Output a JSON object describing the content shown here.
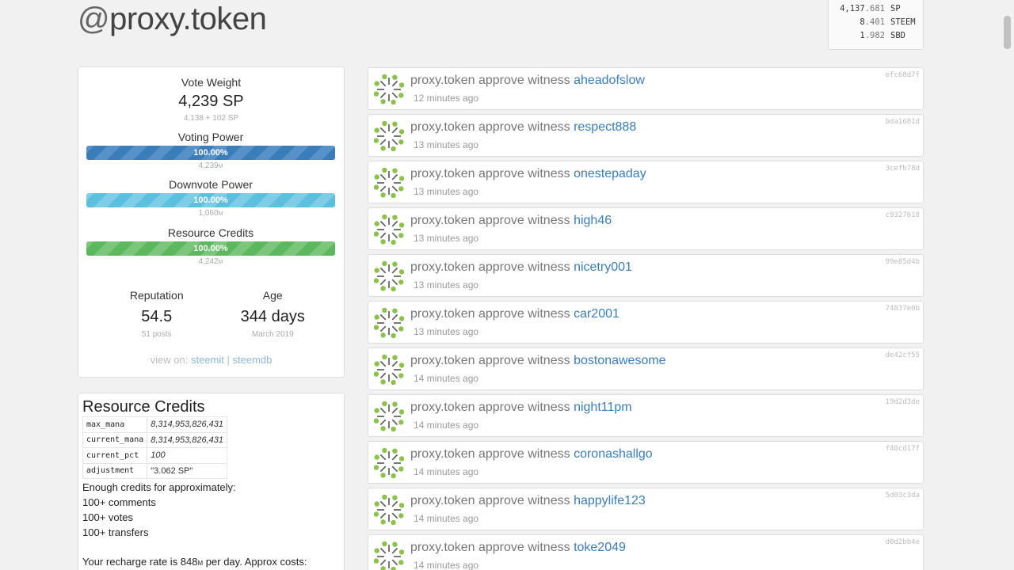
{
  "account": {
    "at": "@",
    "name": "proxy.token"
  },
  "balances": [
    {
      "int": "4,137",
      "dec": ".681",
      "symbol": "SP"
    },
    {
      "int": "8",
      "dec": ".401",
      "symbol": "STEEM"
    },
    {
      "int": "1",
      "dec": ".982",
      "symbol": "SBD"
    }
  ],
  "stats": {
    "vote_weight": {
      "label": "Vote Weight",
      "value": "4,239 SP",
      "sub": "4,138 + 102 SP"
    },
    "voting_power": {
      "label": "Voting Power",
      "percent": "100.00%",
      "fill": 1.0,
      "sub": "4,239",
      "unit": "M"
    },
    "downvote_power": {
      "label": "Downvote Power",
      "percent": "100.00%",
      "fill": 1.0,
      "sub": "1,060",
      "unit": "M"
    },
    "resource_credits": {
      "label": "Resource Credits",
      "percent": "100.00%",
      "fill": 1.0,
      "sub": "4,242",
      "unit": "M"
    },
    "reputation": {
      "label": "Reputation",
      "value": "54.5",
      "sub": "51 posts"
    },
    "age": {
      "label": "Age",
      "value": "344 days",
      "sub": "March 2019"
    },
    "view_on": {
      "prefix": "view on:",
      "steemit": "steemit",
      "sep": "|",
      "steemdb": "steemdb"
    }
  },
  "rc": {
    "title": "Resource Credits",
    "rows": [
      {
        "key": "max_mana",
        "value": "8,314,953,826,431"
      },
      {
        "key": "current_mana",
        "value": "8,314,953,826,431"
      },
      {
        "key": "current_pct",
        "value": "100"
      },
      {
        "key": "adjustment",
        "value": "\"3.062 SP\""
      }
    ],
    "enough_text": "Enough credits for approximately:",
    "comments": "100+ comments",
    "votes": "100+ votes",
    "transfers": "100+ transfers",
    "recharge_prefix": "Your recharge rate is 848",
    "recharge_unit": "M",
    "recharge_suffix": " per day. Approx costs:"
  },
  "ops": [
    {
      "actor": "proxy.token",
      "action": "approve witness",
      "witness": "aheadofslow",
      "time": "12 minutes ago",
      "hash": "efc68d7f"
    },
    {
      "actor": "proxy.token",
      "action": "approve witness",
      "witness": "respect888",
      "time": "13 minutes ago",
      "hash": "bda1681d"
    },
    {
      "actor": "proxy.token",
      "action": "approve witness",
      "witness": "onestepaday",
      "time": "13 minutes ago",
      "hash": "3cefb78d"
    },
    {
      "actor": "proxy.token",
      "action": "approve witness",
      "witness": "high46",
      "time": "13 minutes ago",
      "hash": "c9327618"
    },
    {
      "actor": "proxy.token",
      "action": "approve witness",
      "witness": "nicetry001",
      "time": "13 minutes ago",
      "hash": "99e85d4b"
    },
    {
      "actor": "proxy.token",
      "action": "approve witness",
      "witness": "car2001",
      "time": "13 minutes ago",
      "hash": "74837e0b"
    },
    {
      "actor": "proxy.token",
      "action": "approve witness",
      "witness": "bostonawesome",
      "time": "14 minutes ago",
      "hash": "de42cf55"
    },
    {
      "actor": "proxy.token",
      "action": "approve witness",
      "witness": "night11pm",
      "time": "14 minutes ago",
      "hash": "19d2d3de"
    },
    {
      "actor": "proxy.token",
      "action": "approve witness",
      "witness": "coronashallgo",
      "time": "14 minutes ago",
      "hash": "f40cd17f"
    },
    {
      "actor": "proxy.token",
      "action": "approve witness",
      "witness": "happylife123",
      "time": "14 minutes ago",
      "hash": "5d03c3da"
    },
    {
      "actor": "proxy.token",
      "action": "approve witness",
      "witness": "toke2049",
      "time": "14 minutes ago",
      "hash": "d0d2bb4e"
    }
  ],
  "colors": {
    "link": "#3a7dbb",
    "bar_blue": "#3a7dbb",
    "bar_cyan": "#5bc0de",
    "bar_green": "#5cb85c",
    "avatar_green": "#8bc34a",
    "avatar_dark": "#555555"
  }
}
